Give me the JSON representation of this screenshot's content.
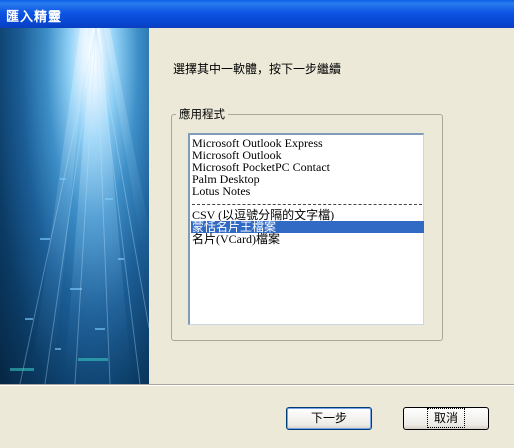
{
  "window": {
    "title": "匯入精靈"
  },
  "wizard": {
    "instruction": "選擇其中一軟體，按下一步繼續"
  },
  "group": {
    "label": "應用程式"
  },
  "list": {
    "items": [
      {
        "label": "Microsoft Outlook Express",
        "selected": false
      },
      {
        "label": "Microsoft Outlook",
        "selected": false
      },
      {
        "label": "Microsoft PocketPC Contact",
        "selected": false
      },
      {
        "label": "Palm Desktop",
        "selected": false
      },
      {
        "label": "Lotus Notes",
        "selected": false
      },
      {
        "label": "CSV (以逗號分隔的文字檔)",
        "selected": false
      },
      {
        "label": "蒙恬名片王檔案",
        "selected": true
      },
      {
        "label": "名片(VCard)檔案",
        "selected": false
      }
    ]
  },
  "buttons": {
    "next": "下一步",
    "cancel": "取消"
  },
  "colors": {
    "selection": "#316ac5",
    "titlebar": "#0a4fd6",
    "background": "#ece9d8"
  }
}
